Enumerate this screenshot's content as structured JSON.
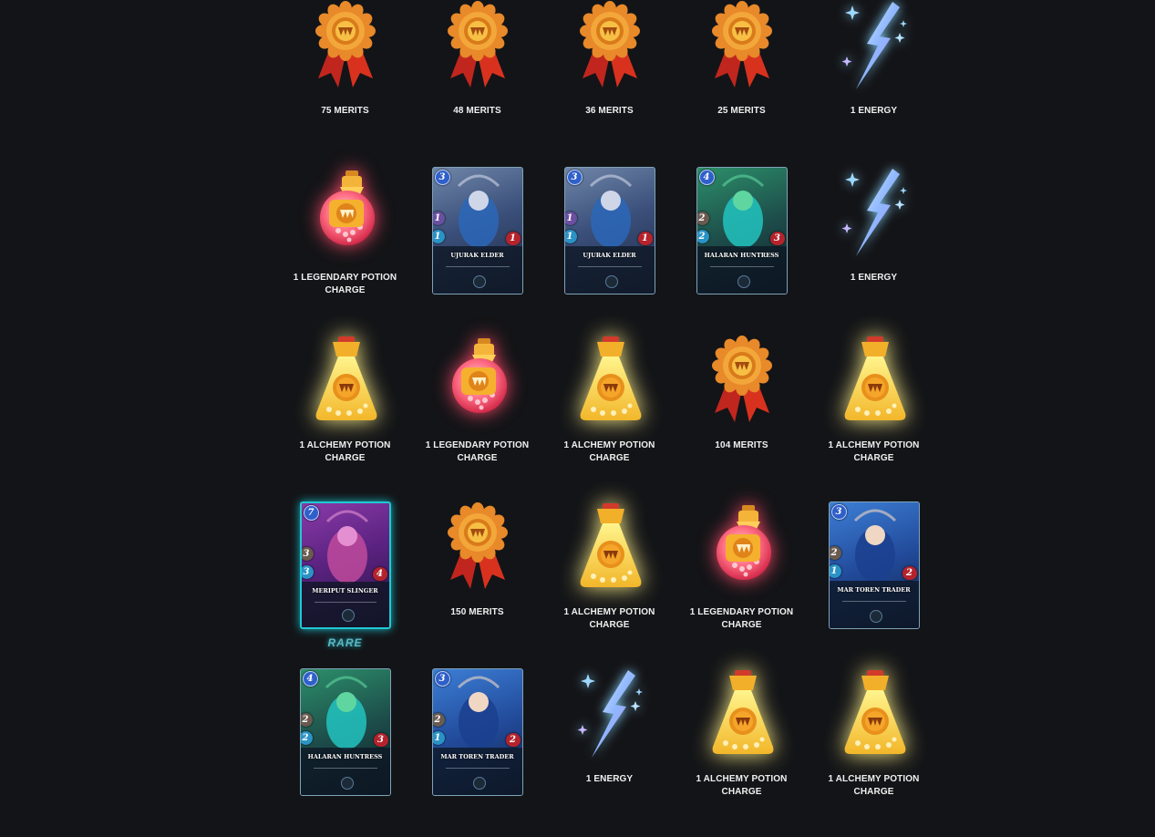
{
  "rows": [
    [
      {
        "type": "merit",
        "label": "75 MERITS"
      },
      {
        "type": "merit",
        "label": "48 MERITS"
      },
      {
        "type": "merit",
        "label": "36 MERITS"
      },
      {
        "type": "merit",
        "label": "25 MERITS"
      },
      {
        "type": "energy",
        "label": "1 ENERGY"
      }
    ],
    [
      {
        "type": "legendary",
        "label": "1 LEGENDARY POTION CHARGE"
      },
      {
        "type": "card",
        "name": "UJURAK ELDER",
        "mana": "3",
        "attack": "1",
        "speed": "1",
        "health": "1",
        "theme": "ujurak",
        "rare": false
      },
      {
        "type": "card",
        "name": "UJURAK ELDER",
        "mana": "3",
        "attack": "1",
        "speed": "1",
        "health": "1",
        "theme": "ujurak",
        "rare": false
      },
      {
        "type": "card",
        "name": "HALARAN HUNTRESS",
        "mana": "4",
        "attack": "2",
        "speed": "2",
        "health": "3",
        "theme": "halaran",
        "rare": false
      },
      {
        "type": "energy",
        "label": "1 ENERGY"
      }
    ],
    [
      {
        "type": "alchemy",
        "label": "1 ALCHEMY POTION CHARGE"
      },
      {
        "type": "legendary",
        "label": "1 LEGENDARY POTION CHARGE"
      },
      {
        "type": "alchemy",
        "label": "1 ALCHEMY POTION CHARGE"
      },
      {
        "type": "merit",
        "label": "104 MERITS"
      },
      {
        "type": "alchemy",
        "label": "1 ALCHEMY POTION CHARGE"
      }
    ],
    [
      {
        "type": "card",
        "name": "MERIPUT SLINGER",
        "mana": "7",
        "attack": "3",
        "speed": "3",
        "health": "4",
        "theme": "meriput",
        "rare": true,
        "rarity_label": "RARE"
      },
      {
        "type": "merit",
        "label": "150 MERITS"
      },
      {
        "type": "alchemy",
        "label": "1 ALCHEMY POTION CHARGE"
      },
      {
        "type": "legendary",
        "label": "1 LEGENDARY POTION CHARGE"
      },
      {
        "type": "card",
        "name": "MAR TOREN TRADER",
        "mana": "3",
        "attack": "2",
        "speed": "1",
        "health": "2",
        "theme": "martoren",
        "rare": false
      }
    ],
    [
      {
        "type": "card",
        "name": "HALARAN HUNTRESS",
        "mana": "4",
        "attack": "2",
        "speed": "2",
        "health": "3",
        "theme": "halaran",
        "rare": false
      },
      {
        "type": "card",
        "name": "MAR TOREN TRADER",
        "mana": "3",
        "attack": "2",
        "speed": "1",
        "health": "2",
        "theme": "martoren",
        "rare": false
      },
      {
        "type": "energy",
        "label": "1 ENERGY"
      },
      {
        "type": "alchemy",
        "label": "1 ALCHEMY POTION CHARGE"
      },
      {
        "type": "alchemy",
        "label": "1 ALCHEMY POTION CHARGE"
      }
    ]
  ],
  "icons": {
    "merit": "merit-medal-icon",
    "energy": "energy-bolt-icon",
    "legendary": "legendary-potion-icon",
    "alchemy": "alchemy-potion-icon"
  },
  "colors": {
    "background": "#131417",
    "rare_glow": "#20c9d4",
    "legendary_glow": "#ff4a6a",
    "alchemy_glow": "#fff18a",
    "energy": "#8ad8ff"
  }
}
